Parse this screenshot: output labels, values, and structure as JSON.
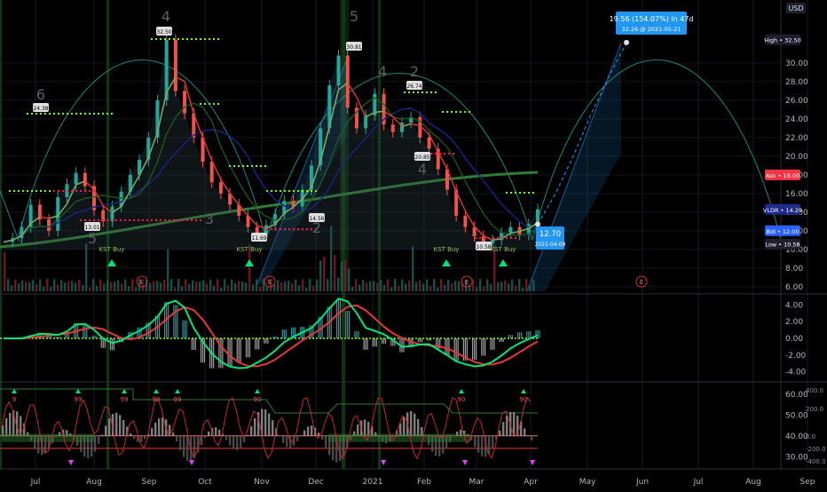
{
  "chart_data": [
    {
      "type": "line",
      "pane": "price",
      "currency_badge": "USD",
      "y_ticks": [
        "30.00",
        "28.00",
        "26.00",
        "24.00",
        "22.00",
        "20.00",
        "18.00",
        "16.00",
        "14.00",
        "12.00",
        "10.00",
        "8.00",
        "6.00"
      ],
      "y_range": [
        5.5,
        36
      ],
      "x_labels": [
        "Jul",
        "Aug",
        "Sep",
        "Oct",
        "Nov",
        "Dec",
        "2021",
        "Feb",
        "Mar",
        "Apr",
        "May",
        "Jun",
        "Jul",
        "Aug",
        "Sep"
      ],
      "price_badges": [
        {
          "label": "High",
          "value": "32.50",
          "color": "#1e1e2e",
          "text_color": "#ffffff"
        },
        {
          "label": "Ask",
          "value": "18.00",
          "color": "#f23645",
          "text_color": "#ffffff"
        },
        {
          "label": "VLDR",
          "value": "14.29",
          "color": "#1e2a8c",
          "text_color": "#ffffff"
        },
        {
          "label": "Bid",
          "value": "12.00",
          "color": "#2962ff",
          "text_color": "#ffffff"
        },
        {
          "label": "Low",
          "value": "10.58",
          "color": "#1e1e2e",
          "text_color": "#ffffff"
        }
      ],
      "measure_tooltip": {
        "line1": "19.56 (154.07%) in 47d",
        "line2": "32.26 @ 2021-05-21"
      },
      "start_marker": {
        "value": "12.70",
        "date": "2021-04-09"
      },
      "swing_labels": [
        "24.38",
        "32.50",
        "13.01",
        "11.69",
        "14.56",
        "30.81",
        "26.74",
        "20.85",
        "10.58"
      ],
      "wave_numbers": [
        "6",
        "4",
        "3",
        "5",
        "5",
        "2",
        "4",
        "2",
        "4"
      ],
      "kst_labels": [
        "KST Buy",
        "KST Buy",
        "KST Buy",
        "KST Buy"
      ],
      "earnings_marker": "E",
      "close_series": [
        10.8,
        11.2,
        12.4,
        14.8,
        13.2,
        12.0,
        15.6,
        17.0,
        18.2,
        16.8,
        14.2,
        13.0,
        14.6,
        16.2,
        18.0,
        19.6,
        22.0,
        26.0,
        32.5,
        27.0,
        24.6,
        22.0,
        19.4,
        17.2,
        16.0,
        14.8,
        13.6,
        12.4,
        11.7,
        12.6,
        13.8,
        15.2,
        14.6,
        16.4,
        19.0,
        23.0,
        27.6,
        30.8,
        25.2,
        23.0,
        24.4,
        26.7,
        23.4,
        22.6,
        23.6,
        24.2,
        22.0,
        20.8,
        18.6,
        16.4,
        13.6,
        12.4,
        11.4,
        10.6,
        11.0,
        11.8,
        12.4,
        11.6,
        12.7,
        14.3
      ],
      "projection": [
        12.7,
        16.0,
        20.0,
        24.5,
        28.5,
        32.2
      ]
    },
    {
      "type": "line",
      "pane": "macd",
      "y_ticks": [
        "4.00",
        "2.00",
        "0.00",
        "-2.00",
        "-4.00"
      ],
      "y_range": [
        -5,
        5
      ]
    },
    {
      "type": "line",
      "pane": "oscillator",
      "y_ticks_left": [
        "60.00",
        "50.00",
        "40.00",
        "30.00"
      ],
      "y_ticks_right": [
        "400.0",
        "200.0",
        "0.0",
        "-200.0",
        "-400.0"
      ],
      "y_range": [
        25,
        65
      ],
      "signal_labels": [
        "9",
        "99",
        "99",
        "90",
        "99",
        "90",
        "90",
        "90"
      ]
    }
  ]
}
